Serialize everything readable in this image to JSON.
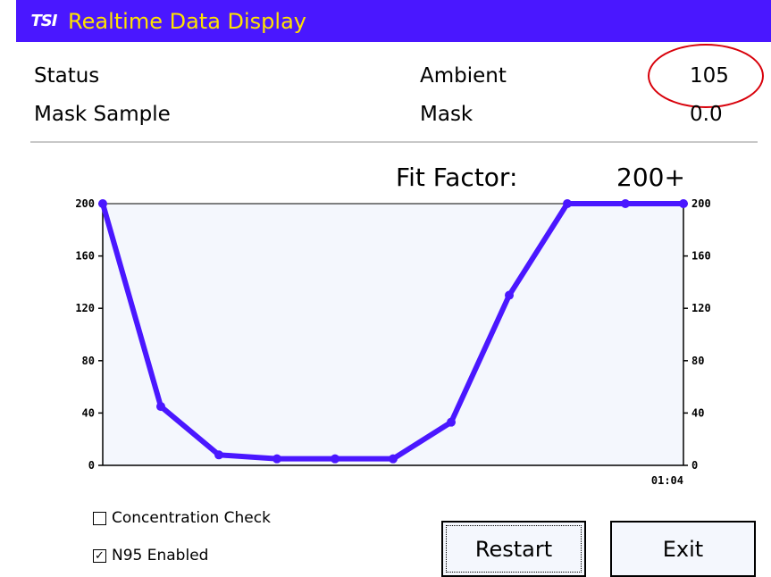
{
  "titlebar": {
    "logo": "TSI",
    "title": "Realtime Data Display",
    "bg_color": "#4a17ff",
    "title_color": "#ffe200"
  },
  "readings": {
    "status_label": "Status",
    "ambient_label": "Ambient",
    "ambient_value": "105",
    "mask_sample_label": "Mask Sample",
    "mask_label": "Mask",
    "mask_value": "0.0",
    "highlight_color": "#d8000a"
  },
  "fit_factor": {
    "label": "Fit Factor:",
    "value": "200+"
  },
  "chart_data": {
    "type": "line",
    "x": [
      1,
      2,
      3,
      4,
      5,
      6,
      7,
      8,
      9,
      10,
      11
    ],
    "series": [
      {
        "values": [
          200,
          45,
          8,
          5,
          5,
          5,
          33,
          130,
          200,
          200,
          200
        ],
        "color": "#4a17ff"
      }
    ],
    "y_ticks": [
      "0",
      "40",
      "80",
      "120",
      "160",
      "200"
    ],
    "ylim": [
      0,
      200
    ],
    "x_end_label": "01:04",
    "grid": false,
    "plot_bg": "#f4f7fd"
  },
  "options": {
    "concentration_check": {
      "label": "Concentration Check",
      "checked": false
    },
    "n95_enabled": {
      "label": "N95 Enabled",
      "checked": true
    }
  },
  "buttons": {
    "restart": "Restart",
    "exit": "Exit"
  }
}
